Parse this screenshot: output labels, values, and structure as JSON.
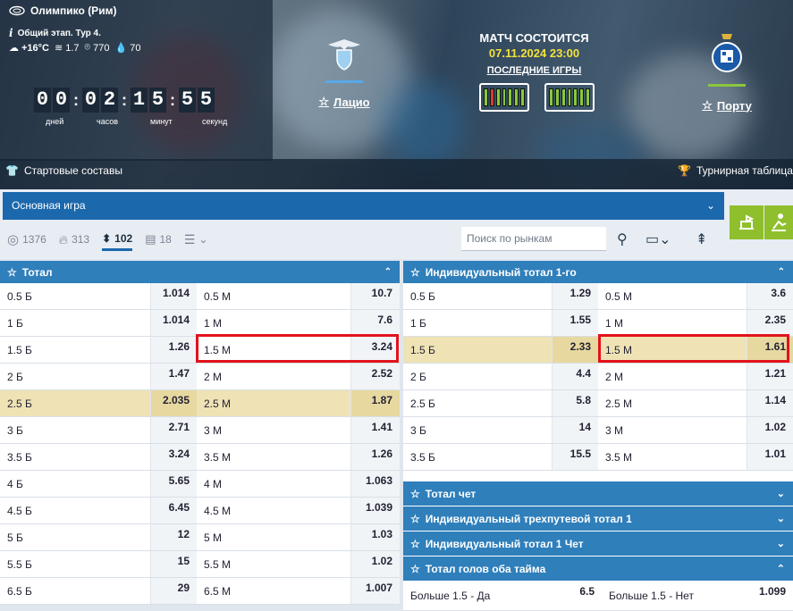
{
  "venue": "Олимпико (Рим)",
  "stage": "Общий этап. Тур 4.",
  "weather": {
    "temp": "+16°C",
    "wind": "1.7",
    "pressure": "770",
    "humidity": "70"
  },
  "timer": {
    "digits": [
      "0",
      "0",
      "0",
      "2",
      "1",
      "5",
      "5",
      "5"
    ],
    "labels": {
      "days": "дней",
      "hours": "часов",
      "minutes": "минут",
      "seconds": "секунд"
    }
  },
  "home_team": {
    "name": "Лацио",
    "bar_color": "#5aa9e6"
  },
  "away_team": {
    "name": "Порту",
    "bar_color": "#8cc63f"
  },
  "match": {
    "status": "МАТЧ СОСТОИТСЯ",
    "datetime": "07.11.2024 23:00",
    "last_games": "ПОСЛЕДНИЕ ИГРЫ"
  },
  "hero_bottom": {
    "lineups": "Стартовые составы",
    "standings": "Турнирная таблица"
  },
  "main_select": "Основная игра",
  "tabs": [
    {
      "icon": "target-icon",
      "count": "1376"
    },
    {
      "icon": "fire-icon",
      "count": "313"
    },
    {
      "icon": "sort-icon",
      "count": "102"
    },
    {
      "icon": "stats-icon",
      "count": "18"
    }
  ],
  "search_placeholder": "Поиск по рынкам",
  "panel_total": {
    "title": "Тотал",
    "rows": [
      [
        "0.5 Б",
        "1.014",
        "0.5 М",
        "10.7"
      ],
      [
        "1 Б",
        "1.014",
        "1 М",
        "7.6"
      ],
      [
        "1.5 Б",
        "1.26",
        "1.5 М",
        "3.24"
      ],
      [
        "2 Б",
        "1.47",
        "2 М",
        "2.52"
      ],
      [
        "2.5 Б",
        "2.035",
        "2.5 М",
        "1.87"
      ],
      [
        "3 Б",
        "2.71",
        "3 М",
        "1.41"
      ],
      [
        "3.5 Б",
        "3.24",
        "3.5 М",
        "1.26"
      ],
      [
        "4 Б",
        "5.65",
        "4 М",
        "1.063"
      ],
      [
        "4.5 Б",
        "6.45",
        "4.5 М",
        "1.039"
      ],
      [
        "5 Б",
        "12",
        "5 М",
        "1.03"
      ],
      [
        "5.5 Б",
        "15",
        "5.5 М",
        "1.02"
      ],
      [
        "6.5 Б",
        "29",
        "6.5 М",
        "1.007"
      ]
    ]
  },
  "panel_ind": {
    "title": "Индивидуальный тотал 1-го",
    "rows": [
      [
        "0.5 Б",
        "1.29",
        "0.5 М",
        "3.6"
      ],
      [
        "1 Б",
        "1.55",
        "1 М",
        "2.35"
      ],
      [
        "1.5 Б",
        "2.33",
        "1.5 М",
        "1.61"
      ],
      [
        "2 Б",
        "4.4",
        "2 М",
        "1.21"
      ],
      [
        "2.5 Б",
        "5.8",
        "2.5 М",
        "1.14"
      ],
      [
        "3 Б",
        "14",
        "3 М",
        "1.02"
      ],
      [
        "3.5 Б",
        "15.5",
        "3.5 М",
        "1.01"
      ]
    ]
  },
  "collapsed_markets": [
    "Тотал чет",
    "Индивидуальный трехпутевой тотал 1",
    "Индивидуальный тотал 1 Чет"
  ],
  "both_halves": {
    "title": "Тотал голов оба тайма",
    "row": [
      "Больше 1.5 - Да",
      "6.5",
      "Больше 1.5 - Нет",
      "1.099"
    ]
  }
}
